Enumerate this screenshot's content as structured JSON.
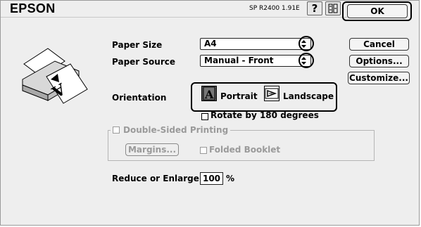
{
  "header": {
    "brand": "EPSON",
    "version": "SP R2400 1.91E"
  },
  "buttons": {
    "ok": "OK",
    "cancel": "Cancel",
    "options": "Options...",
    "customize": "Customize..."
  },
  "paper": {
    "size_label": "Paper Size",
    "size_value": "A4",
    "source_label": "Paper Source",
    "source_value": "Manual - Front"
  },
  "orientation": {
    "label": "Orientation",
    "portrait": "Portrait",
    "landscape": "Landscape",
    "selected": "Portrait",
    "rotate_label": "Rotate by 180 degrees"
  },
  "duplex": {
    "label": "Double-Sided Printing",
    "margins": "Margins...",
    "folded_booklet": "Folded Booklet"
  },
  "scale": {
    "label": "Reduce or Enlarge",
    "value": "100",
    "unit": "%"
  },
  "icons": {
    "help": "question-mark-icon",
    "advanced": "printer-settings-icon",
    "illustration": "printer-feed-illustration-icon"
  }
}
